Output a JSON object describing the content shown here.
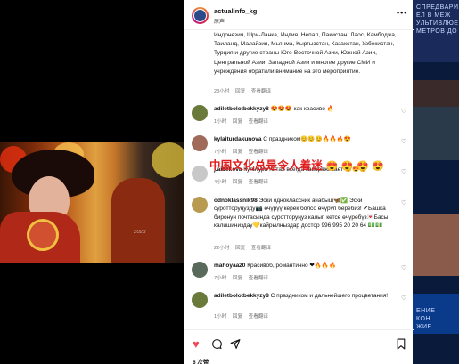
{
  "header": {
    "username": "actualinfo_kg",
    "subtitle": "原声",
    "more_icon": "more-horizontal-icon"
  },
  "caption": {
    "text": "Индонезия, Шри-Ланка, Индия, Непал, Пакистан, Лаос, Камбоджа, Таиланд, Малайзия, Мьянма, Кыргызстан, Казахстан, Узбекистан, Турция и другие страны Юго-Восточной Азии, Южной Азии, Центральной Азии, Западной Азии и многие другие СМИ и учреждения обратили внимание на это мероприятие.",
    "time": "23小时",
    "reply": "回复",
    "translate": "查看翻译"
  },
  "comments": [
    {
      "username": "adiletbolotbekkyzy8",
      "text": "😍😍😍 как красиво 🔥",
      "time": "1小时",
      "reply": "回复",
      "translate": "查看翻译"
    },
    {
      "username": "kylaiturdakunova",
      "text": "С праздником😊😊😊🔥🔥🔥😍",
      "time": "7小时",
      "reply": "回复",
      "translate": "查看翻译"
    },
    {
      "username": "j.aibekova",
      "text": "Культура Китая всегда завораживает 😍😍😍",
      "time": "4小时",
      "reply": "回复",
      "translate": "查看翻译"
    },
    {
      "username": "odnoklassnik98",
      "text": "Эски одноклассник ачабыш🦋✅ Эски суротторуңузду📷 өчүрүү керек болсо өчүрүп беребиз! ✔Башка биронун почтасында суротторуңуз калып кетсе өчүрөбүз💌Басы калишиниздау💛кайрылныздар достор 996 995 20 20 64 💵💵",
      "time": "22小时",
      "reply": "回复",
      "translate": "查看翻译"
    },
    {
      "username": "mahoyaa20",
      "text": "Красивоб, романтично ❤🔥🔥🔥",
      "time": "7小时",
      "reply": "回复",
      "translate": "查看翻译"
    },
    {
      "username": "adiletbolotbekkyzy8",
      "text": "С праздником и дальнейшего процветания!",
      "time": "1小时",
      "reply": "回复",
      "translate": "查看翻译"
    }
  ],
  "overlay_text": "中国文化总是令人着迷",
  "overlay_emoji": "😍 😍 😍 😍",
  "actions": {
    "like_icon": "heart-icon",
    "comment_icon": "comment-icon",
    "share_icon": "share-icon",
    "save_icon": "bookmark-icon",
    "likes": "6 次赞"
  },
  "media": {
    "watermark": "2023"
  },
  "backdrop": {
    "text_top": "СПРЕДВАРИЯ\nЕЛ В МЕЖ\nУЛЬТИВЛЮЕ\nМЕТРОВ ДО",
    "text_mid": "ЕНИЕ\nКОН\nЖИЕ"
  }
}
